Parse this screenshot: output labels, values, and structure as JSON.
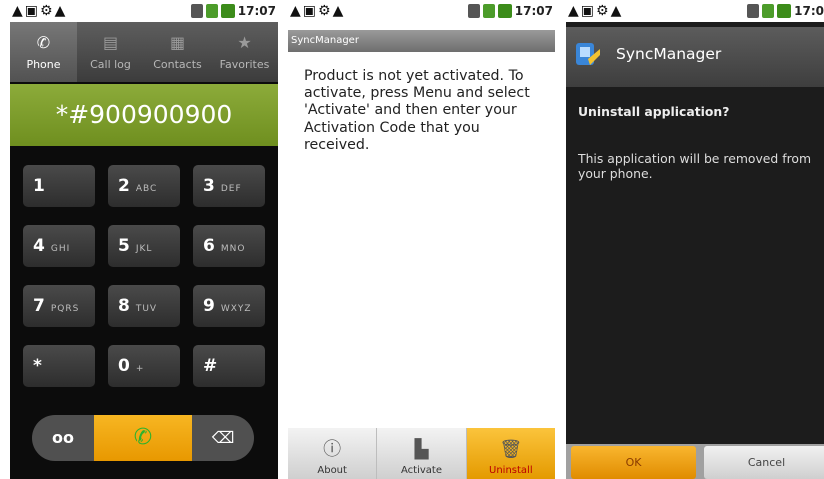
{
  "status_time": "17:07",
  "status_time_clipped": "17:0",
  "dialer": {
    "tabs": [
      {
        "label": "Phone",
        "icon": "phone-icon"
      },
      {
        "label": "Call log",
        "icon": "call-log-icon"
      },
      {
        "label": "Contacts",
        "icon": "contacts-icon"
      },
      {
        "label": "Favorites",
        "icon": "star-icon"
      }
    ],
    "digits": "*#900900900",
    "keys": [
      {
        "digit": "1",
        "letters": ""
      },
      {
        "digit": "2",
        "letters": "ABC"
      },
      {
        "digit": "3",
        "letters": "DEF"
      },
      {
        "digit": "4",
        "letters": "GHI"
      },
      {
        "digit": "5",
        "letters": "JKL"
      },
      {
        "digit": "6",
        "letters": "MNO"
      },
      {
        "digit": "7",
        "letters": "PQRS"
      },
      {
        "digit": "8",
        "letters": "TUV"
      },
      {
        "digit": "9",
        "letters": "WXYZ"
      },
      {
        "digit": "*",
        "letters": ""
      },
      {
        "digit": "0",
        "letters": "+"
      },
      {
        "digit": "#",
        "letters": ""
      }
    ]
  },
  "syncmanager": {
    "title": "SyncManager",
    "message": "Product is not yet activated. To activate, press Menu and select 'Activate' and then enter your Activation Code that you received.",
    "menu": {
      "about": "About",
      "activate": "Activate",
      "uninstall": "Uninstall"
    }
  },
  "uninstall_dialog": {
    "title": "SyncManager",
    "heading": "Uninstall application?",
    "body": "This application will be removed from your phone.",
    "ok": "OK",
    "cancel": "Cancel"
  },
  "colors": {
    "accent_orange": "#f5a800",
    "dialer_green": "#7d9d2b"
  }
}
